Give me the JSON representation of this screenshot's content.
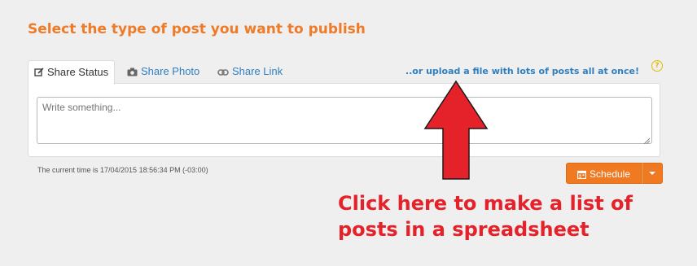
{
  "heading": "Select the type of post you want to publish",
  "tabs": [
    {
      "label": "Share Status",
      "icon": "edit-icon",
      "active": true
    },
    {
      "label": "Share Photo",
      "icon": "camera-icon",
      "active": false
    },
    {
      "label": "Share Link",
      "icon": "link-icon",
      "active": false
    }
  ],
  "upload_link": "..or upload a file with lots of posts all at once!",
  "help_icon": "?",
  "composer": {
    "placeholder": "Write something..."
  },
  "current_time": "The current time is 17/04/2015 18:56:34 PM (-03:00)",
  "schedule": {
    "label": "Schedule",
    "icon": "calendar-icon"
  },
  "annotation": "Click here to make a list of posts in a spreadsheet",
  "colors": {
    "accent": "#ef7a28",
    "link": "#2e7fc0",
    "annotation": "#e52229",
    "button": "#f07a22"
  }
}
